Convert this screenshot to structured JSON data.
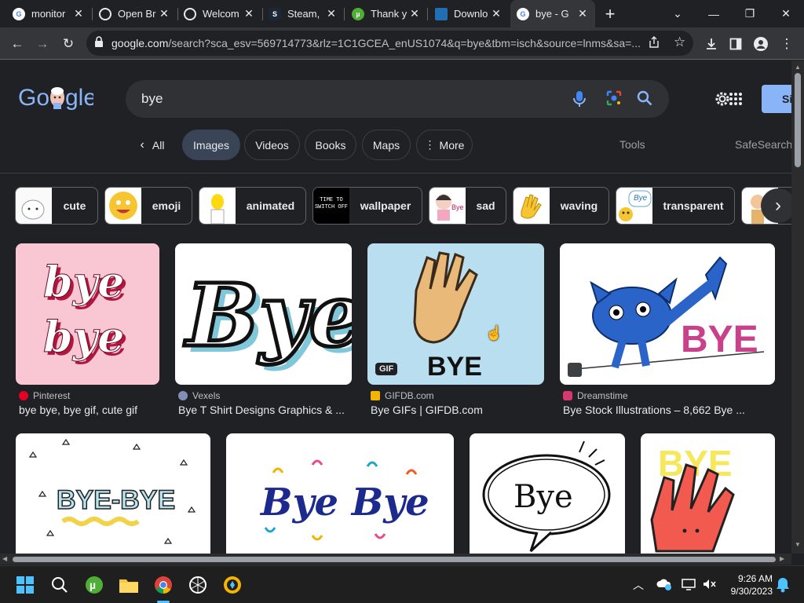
{
  "browser": {
    "tabs": [
      {
        "title": "monitor",
        "favicon": "google-icon"
      },
      {
        "title": "Open Br",
        "favicon": "openai-icon"
      },
      {
        "title": "Welcom",
        "favicon": "globe-icon"
      },
      {
        "title": "Steam, ",
        "favicon": "steam-icon"
      },
      {
        "title": "Thank y",
        "favicon": "utorrent-icon"
      },
      {
        "title": "Downlo",
        "favicon": "download-site-icon"
      },
      {
        "title": "bye - G",
        "favicon": "google-icon",
        "active": true
      }
    ],
    "new_tab": "+",
    "url_domain": "google.com",
    "url_path": "/search?sca_esv=569714773&rlz=1C1GCEA_enUS1074&q=bye&tbm=isch&source=lnms&sa=..."
  },
  "search": {
    "query": "bye",
    "sign_in_label": "Si"
  },
  "nav_tabs": [
    {
      "label": "All",
      "has_back_arrow": true
    },
    {
      "label": "Images",
      "selected": true
    },
    {
      "label": "Videos"
    },
    {
      "label": "Books"
    },
    {
      "label": "Maps"
    },
    {
      "label": "More",
      "has_menu_dots": true
    }
  ],
  "tools_label": "Tools",
  "safesearch_label": "SafeSearch",
  "chips": [
    {
      "label": "cute"
    },
    {
      "label": "emoji"
    },
    {
      "label": "animated"
    },
    {
      "label": "wallpaper",
      "thumb_text": "TIME TO SWITCH OFF"
    },
    {
      "label": "sad",
      "thumb_text": "Bye"
    },
    {
      "label": "waving"
    },
    {
      "label": "transparent",
      "thumb_text": "Bye"
    }
  ],
  "results_row1": [
    {
      "source": "Pinterest",
      "caption": "bye bye, bye gif, cute gif",
      "image_text": [
        "bye",
        "bye"
      ]
    },
    {
      "source": "Vexels",
      "caption": "Bye T Shirt Designs Graphics & ...",
      "image_text": [
        "Bye"
      ]
    },
    {
      "source": "GIFDB.com",
      "caption": "Bye GIFs | GIFDB.com",
      "image_text": [
        "BYE"
      ],
      "badge": "GIF"
    },
    {
      "source": "Dreamstime",
      "caption": "Bye Stock Illustrations – 8,662 Bye ...",
      "image_text": [
        "BYE"
      ]
    }
  ],
  "results_row2": [
    {
      "image_text": [
        "BYE-BYE"
      ]
    },
    {
      "image_text": [
        "Bye Bye"
      ]
    },
    {
      "image_text": [
        "Bye"
      ]
    },
    {
      "image_text": [
        "BYE"
      ]
    }
  ],
  "taskbar": {
    "time": "9:26 AM",
    "date": "9/30/2023"
  },
  "colors": {
    "page_bg": "#202124",
    "selected_tab_bg": "#394457",
    "sign_in_button": "#8ab4f8"
  }
}
